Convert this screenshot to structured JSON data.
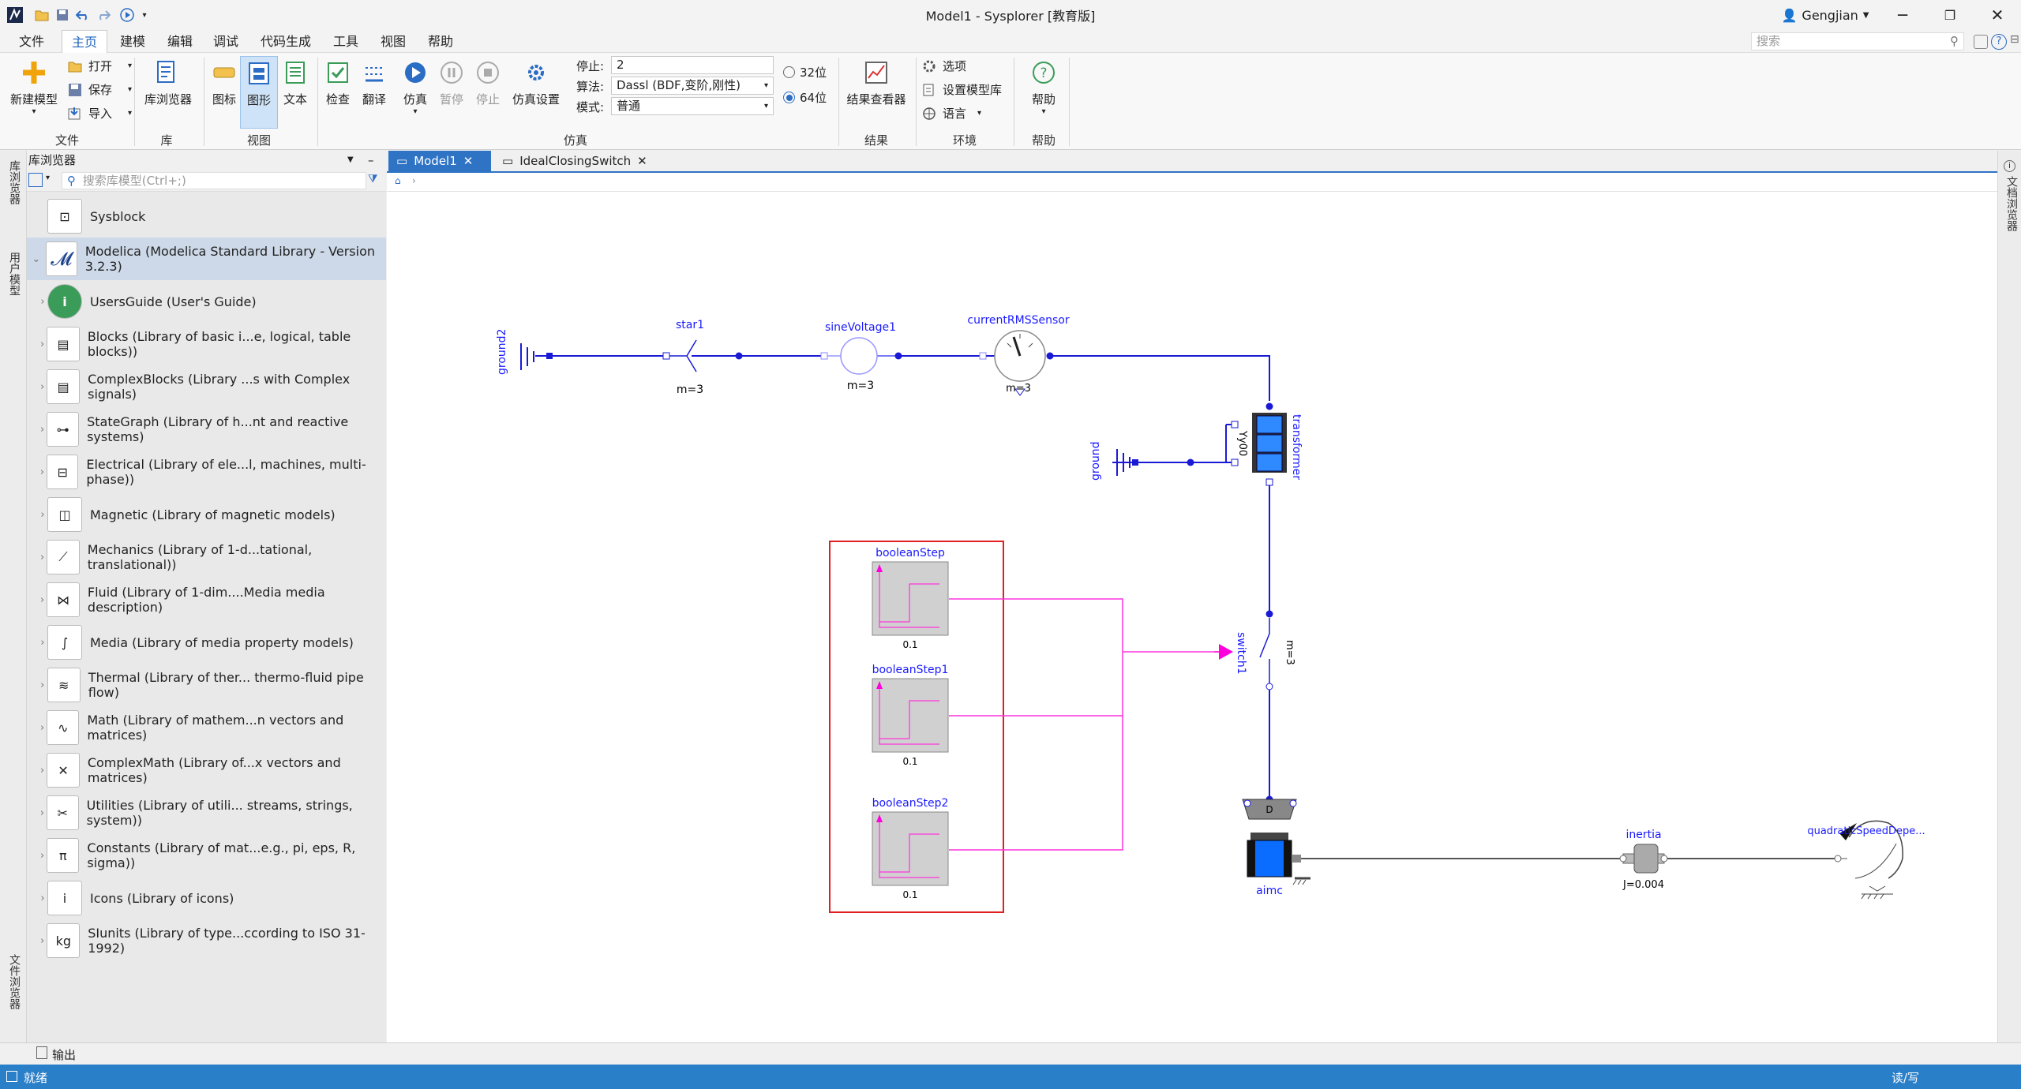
{
  "window": {
    "title": "Model1 - Sysplorer [教育版]",
    "user": "Gengjian",
    "search_placeholder": "搜索"
  },
  "menu": [
    "文件",
    "主页",
    "建模",
    "编辑",
    "调试",
    "代码生成",
    "工具",
    "视图",
    "帮助"
  ],
  "ribbon": {
    "file": {
      "new_model": "新建模型",
      "open": "打开",
      "save": "保存",
      "import": "导入",
      "group": "文件"
    },
    "lib": {
      "browser": "库浏览器",
      "group": "库"
    },
    "view": {
      "icon": "图标",
      "diagram": "图形",
      "text": "文本",
      "group": "视图"
    },
    "sim": {
      "check": "检查",
      "translate": "翻译",
      "simulate": "仿真",
      "pause": "暂停",
      "stop": "停止",
      "settings": "仿真设置",
      "group": "仿真",
      "stop_label": "停止:",
      "stop_value": "2",
      "algo_label": "算法:",
      "algo_value": "Dassl (BDF,变阶,刚性)",
      "mode_label": "模式:",
      "mode_value": "普通",
      "bit32": "32位",
      "bit64": "64位"
    },
    "result": {
      "viewer": "结果查看器",
      "group": "结果"
    },
    "env": {
      "options": "选项",
      "model_lib": "设置模型库",
      "language": "语言",
      "group": "环境"
    },
    "help": {
      "help": "帮助",
      "group": "帮助"
    }
  },
  "left_strip": {
    "lib_browser": "库浏览器",
    "user_model": "用户模型",
    "file_browser": "文件浏览器"
  },
  "right_strip": {
    "doc_browser": "文档浏览器"
  },
  "library": {
    "title": "库浏览器",
    "search_placeholder": "搜索库模型(Ctrl+;)",
    "items": [
      {
        "label": "Sysblock"
      },
      {
        "label": "Modelica (Modelica Standard Library - Version 3.2.3)"
      },
      {
        "label": "UsersGuide (User's Guide)"
      },
      {
        "label": "Blocks (Library of basic i...e, logical, table blocks))"
      },
      {
        "label": "ComplexBlocks (Library ...s with Complex signals)"
      },
      {
        "label": "StateGraph (Library of h...nt and reactive systems)"
      },
      {
        "label": "Electrical (Library of ele...l, machines, multi-phase))"
      },
      {
        "label": "Magnetic (Library of magnetic models)"
      },
      {
        "label": "Mechanics (Library of 1-d...tational, translational))"
      },
      {
        "label": "Fluid (Library of 1-dim....Media media description)"
      },
      {
        "label": "Media (Library of media property models)"
      },
      {
        "label": "Thermal (Library of ther... thermo-fluid pipe flow)"
      },
      {
        "label": "Math (Library of mathem...n vectors and matrices)"
      },
      {
        "label": "ComplexMath (Library of...x vectors and matrices)"
      },
      {
        "label": "Utilities (Library of utili... streams, strings, system))"
      },
      {
        "label": "Constants (Library of mat...e.g., pi, eps, R, sigma))"
      },
      {
        "label": "Icons (Library of icons)"
      },
      {
        "label": "SIunits (Library of type...ccording to ISO 31-1992)"
      }
    ]
  },
  "tabs": [
    {
      "label": "Model1"
    },
    {
      "label": "IdealClosingSwitch"
    }
  ],
  "diagram": {
    "ground2": "ground2",
    "star1": "star1",
    "star1_m": "m=3",
    "sine": "sineVoltage1",
    "sine_m": "m=3",
    "rms": "currentRMSSensor",
    "rms_m": "m=3",
    "transformer": "transformer",
    "transformer_code": "Yy00",
    "ground": "ground",
    "bs0": "booleanStep",
    "bs0_v": "0.1",
    "bs1": "booleanStep1",
    "bs1_v": "0.1",
    "bs2": "booleanStep2",
    "bs2_v": "0.1",
    "switch": "switch1",
    "switch_m": "m=3",
    "aimc": "aimc",
    "aimc_d": "D",
    "inertia": "inertia",
    "inertia_j": "J=0.004",
    "load": "quadraticSpeedDepe..."
  },
  "output": "输出",
  "status": {
    "left": "就绪",
    "right": "读/写"
  }
}
